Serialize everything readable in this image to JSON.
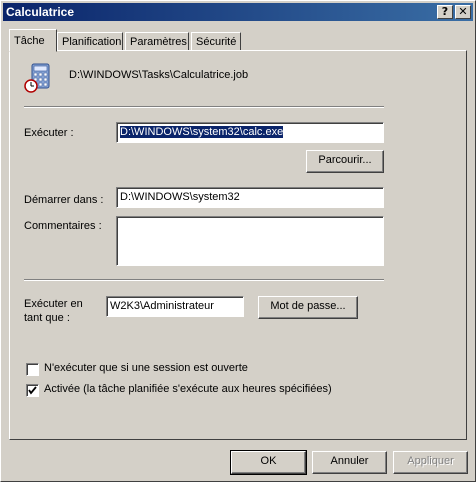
{
  "window": {
    "title": "Calculatrice"
  },
  "titlebar": {
    "help_glyph": "?",
    "close_glyph": "✕"
  },
  "tabs": [
    {
      "label": "Tâche",
      "active": true
    },
    {
      "label": "Planification",
      "active": false
    },
    {
      "label": "Paramètres",
      "active": false
    },
    {
      "label": "Sécurité",
      "active": false
    }
  ],
  "task": {
    "icon": "calculator-icon",
    "path": "D:\\WINDOWS\\Tasks\\Calculatrice.job"
  },
  "fields": {
    "run_label": "Exécuter :",
    "run_value": "D:\\WINDOWS\\system32\\calc.exe",
    "browse_label": "Parcourir...",
    "start_in_label": "Démarrer dans :",
    "start_in_value": "D:\\WINDOWS\\system32",
    "comments_label": "Commentaires :",
    "comments_value": "",
    "run_as_label_1": "Exécuter en",
    "run_as_label_2": "tant que :",
    "run_as_value": "W2K3\\Administrateur",
    "password_label": "Mot de passe..."
  },
  "options": {
    "logged_on_only": {
      "label": "N'exécuter que si une session est ouverte",
      "checked": false
    },
    "enabled": {
      "label": "Activée (la tâche planifiée s'exécute aux heures spécifiées)",
      "checked": true
    }
  },
  "buttons": {
    "ok": "OK",
    "cancel": "Annuler",
    "apply": "Appliquer"
  },
  "colors": {
    "titlebar_start": "#0a246a",
    "titlebar_end": "#3a6ea5",
    "face": "#d4d0c8",
    "selection": "#0a246a"
  }
}
